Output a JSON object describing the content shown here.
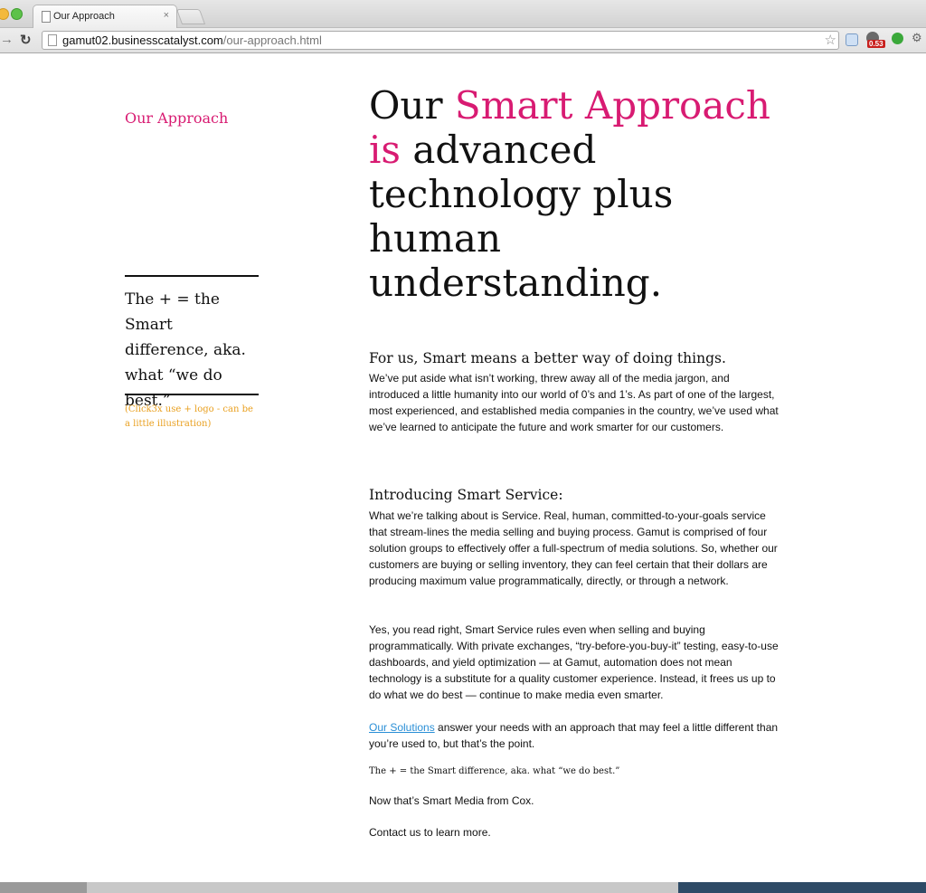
{
  "browser": {
    "tab_title": "Our Approach",
    "tab_close": "×",
    "url_host": "gamut02.businesscatalyst.com",
    "url_path": "/our-approach.html",
    "extension_badge": "0.53"
  },
  "sidebar": {
    "title": "Our Approach",
    "quote": "The + = the Smart difference, aka. what “we do best.”",
    "note": "(Click3x use + logo - can be a little illustration)"
  },
  "headline": {
    "part1": "Our ",
    "highlight1": "Smart Approach",
    "highlight2": "is",
    "part2": " advanced technology plus human understanding."
  },
  "section1": {
    "heading": "For us, Smart means a better way of doing things.",
    "body": "We’ve put aside what isn’t working, threw away all of the media jargon, and introduced a little humanity into our world of 0’s and 1’s. As part of one of the largest, most experienced, and established media companies in the country, we’ve used what we’ve learned to anticipate the future and work smarter for our customers."
  },
  "section2": {
    "heading": "Introducing Smart Service:",
    "body1": "What we’re talking about is Service. Real, human, committed-to-your-goals service that stream-lines the media selling and buying process. Gamut is comprised of four solution groups to effectively offer a full-spectrum of media solutions. So, whether our customers are buying or selling inventory, they can feel certain that their dollars are producing maximum value programmatically, directly, or through a network.",
    "body2": "Yes, you read right, Smart Service rules even when selling and buying programmatically. With private exchanges, “try-before-you-buy-it” testing, easy-to-use dashboards, and yield optimization — at Gamut, automation does not mean technology is a substitute for a quality customer experience. Instead, it frees us up to do what we do best — continue to make media even smarter.",
    "link_text": "Our Solutions",
    "body3_after_link": " answer your needs with an approach that may feel a little different than you’re used to, but that’s the point.",
    "tagline": "The + = the Smart difference, aka. what “we do best.”",
    "closing1": "Now that’s Smart Media from Cox.",
    "closing2": "Contact us to learn more."
  },
  "colors": {
    "accent_pink": "#d81b72",
    "note_orange": "#e9a020",
    "link_blue": "#2a8fd6"
  }
}
